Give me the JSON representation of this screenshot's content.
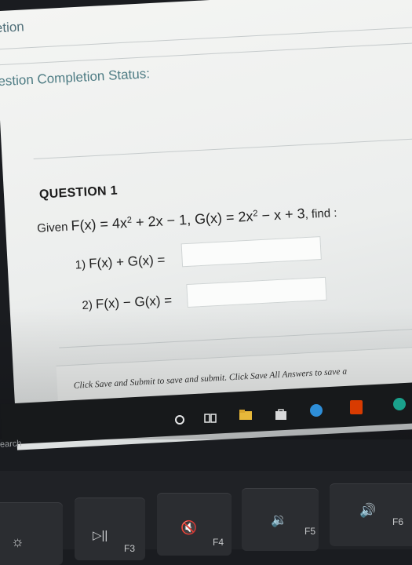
{
  "screen": {
    "top_title": "etion",
    "status_label": "estion Completion Status:",
    "question_title": "QUESTION 1",
    "given_prefix": "Given ",
    "given_math": "F(x) = 4x",
    "given_math_2": " + 2x − 1, G(x) = 2x",
    "given_math_3": " − x + 3",
    "given_suffix": ", find :",
    "superscript": "2",
    "part1_num": "1)",
    "part1_expr": "F(x) + G(x) =",
    "part1_value": "",
    "part2_num": "2)",
    "part2_expr": "F(x) − G(x) =",
    "part2_value": "",
    "submit_instruction": "Click Save and Submit to save and submit. Click Save All Answers to save a"
  },
  "taskbar": {
    "search_label": "earch",
    "icons": [
      "cortana-icon",
      "task-view-icon",
      "file-explorer-icon",
      "store-icon",
      "skype-icon",
      "office-icon",
      "edge-icon"
    ]
  },
  "keyboard": {
    "keys": [
      {
        "label": "",
        "glyph": "☼"
      },
      {
        "label": "F3",
        "glyph": "▷||"
      },
      {
        "label": "F4",
        "glyph": "🔇"
      },
      {
        "label": "F5",
        "glyph": "🔉"
      },
      {
        "label": "F6",
        "glyph": "🔊"
      }
    ],
    "f3_partial": "F3"
  }
}
